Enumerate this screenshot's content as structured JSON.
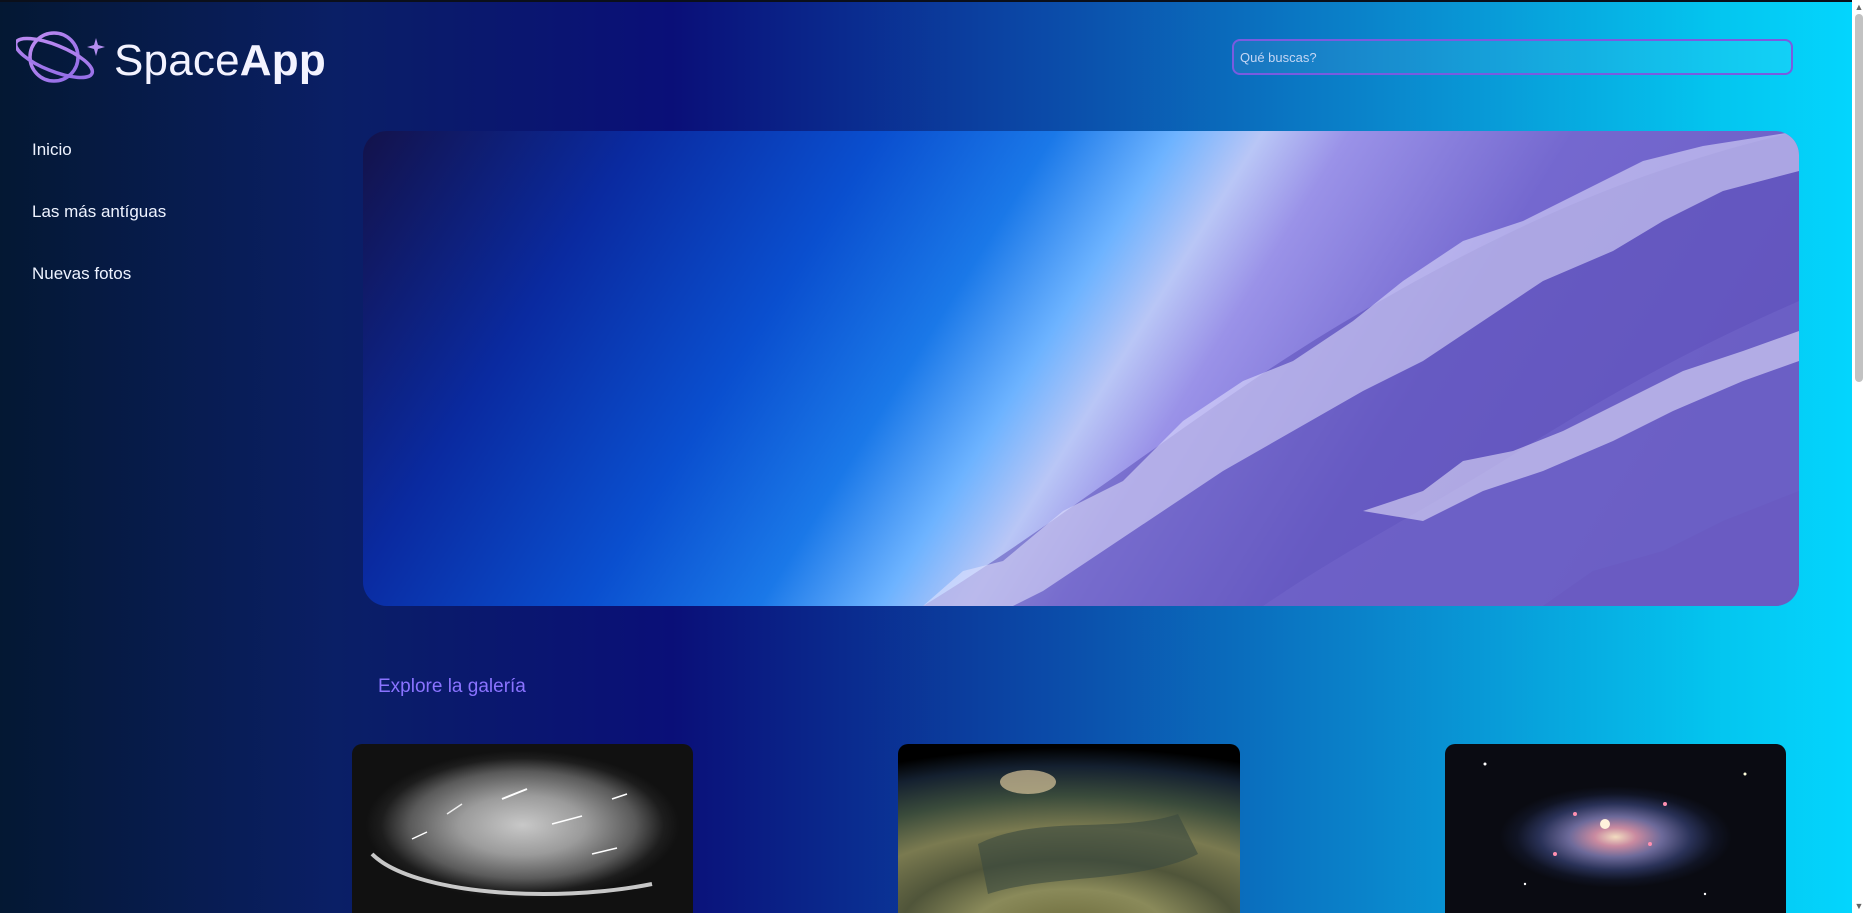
{
  "header": {
    "brand_light": "Space",
    "brand_bold": "App",
    "search_placeholder": "Qué buscas?"
  },
  "sidebar": {
    "items": [
      {
        "label": "Inicio"
      },
      {
        "label": "Las más antíguas"
      },
      {
        "label": "Nuevas fotos"
      }
    ]
  },
  "main": {
    "gallery_title": "Explore la galería",
    "gallery": [
      {
        "icon": "meteor-shower-photo"
      },
      {
        "icon": "planet-surface-photo"
      },
      {
        "icon": "spiral-galaxy-photo"
      }
    ]
  },
  "colors": {
    "accent": "#8a73ff",
    "search_border": "#7a5be0",
    "text": "#eef3ff"
  }
}
